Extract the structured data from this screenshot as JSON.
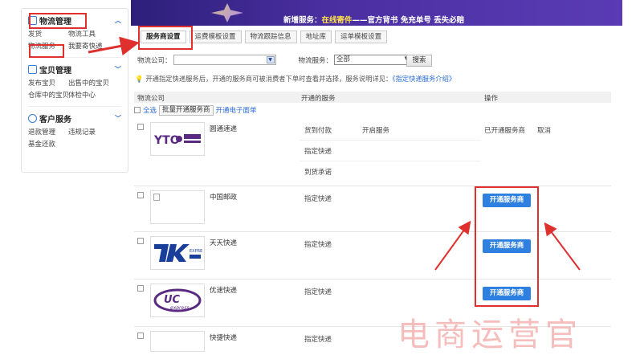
{
  "banner": {
    "prefix": "新增服务：",
    "highlight": "在线寄件",
    "suffix": "——官方背书 免充单号 丢失必赔"
  },
  "sidebar": {
    "sections": [
      {
        "title": "物流管理",
        "icon": "logistics-icon",
        "links": [
          "发货",
          "物流工具",
          "物流服务",
          "我要寄快递"
        ]
      },
      {
        "title": "宝贝管理",
        "icon": "gift-icon",
        "links": [
          "发布宝贝",
          "出售中的宝贝",
          "仓库中的宝贝",
          "体检中心"
        ]
      },
      {
        "title": "客户服务",
        "icon": "customer-icon",
        "links": [
          "退款管理",
          "违规记录",
          "基金还款"
        ]
      }
    ]
  },
  "tabs": [
    "服务商设置",
    "运费模板设置",
    "物流跟踪信息",
    "地址库",
    "运单模板设置"
  ],
  "filter": {
    "company_label": "物流公司：",
    "company_value": "",
    "service_label": "物流服务：",
    "service_value": "全部",
    "search_label": "搜索"
  },
  "notice": {
    "text": "开通指定快递服务后，开通的服务商可被消费者下单时查看并选择，服务说明详见：",
    "link": "《指定快递服务介绍》"
  },
  "table": {
    "headers": [
      "物流公司",
      "开通的服务",
      "操作"
    ],
    "select_all": "全选",
    "batch_button": "批量开通服务商",
    "e_form_link": "开通电子面单",
    "rows": [
      {
        "name": "圆通速递",
        "logo": "YTO 圆通速递 EXPRESS",
        "services": [
          "货到付款",
          "指定快递",
          "到货承诺"
        ],
        "service_action": "开启服务",
        "status": "已开通服务商",
        "cancel": "取消"
      },
      {
        "name": "中国邮政",
        "logo": "",
        "services": [
          "指定快递"
        ],
        "button": "开通服务商"
      },
      {
        "name": "天天快递",
        "logo": "TTK EXPRESS 天天快递",
        "services": [
          "指定快递"
        ],
        "button": "开通服务商"
      },
      {
        "name": "优速快递",
        "logo": "UC express",
        "services": [
          "指定快递"
        ],
        "button": "开通服务商"
      },
      {
        "name": "快捷快递",
        "logo": "",
        "services": [
          "指定快递"
        ]
      }
    ]
  },
  "watermark": "电商运营官",
  "colors": {
    "accent": "#2d7fe0",
    "highlight": "#e0302e",
    "banner": "#3b2690"
  }
}
